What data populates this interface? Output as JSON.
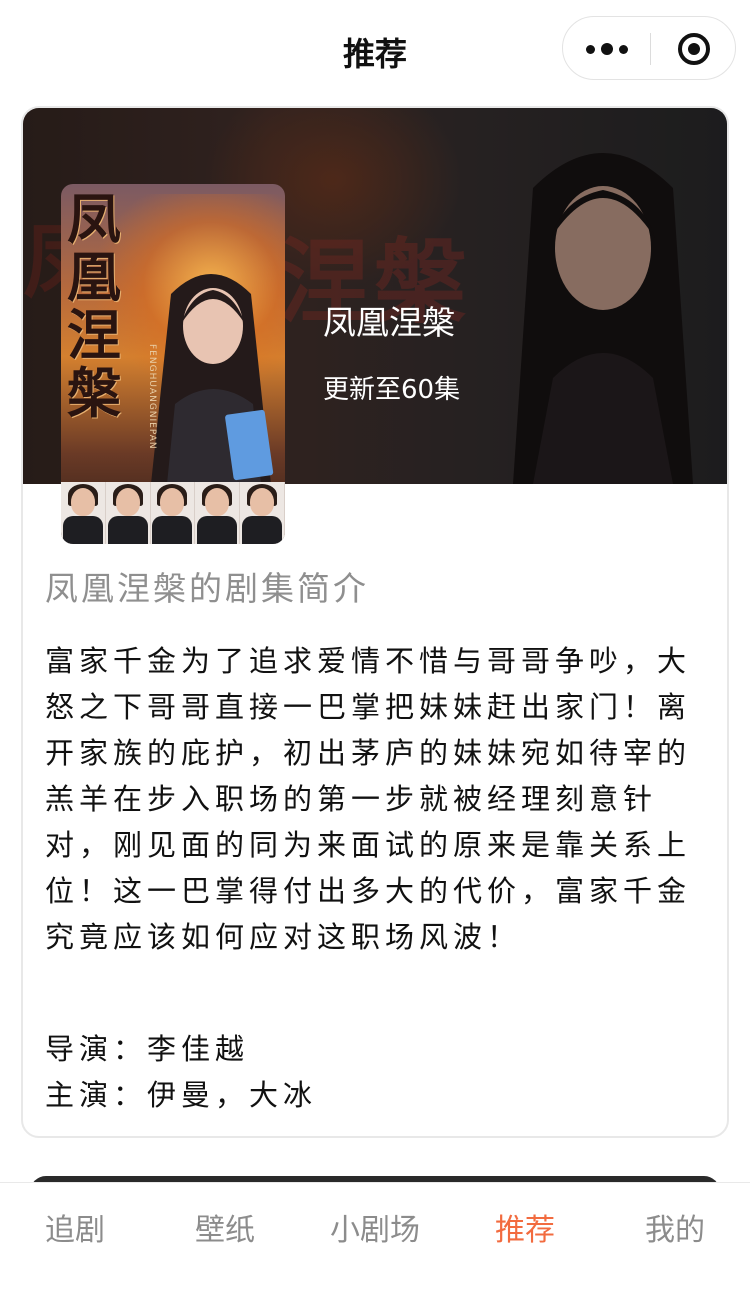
{
  "header": {
    "title": "推荐"
  },
  "capsule": {
    "more_icon": "more-dots-icon",
    "close_icon": "target-circle-icon"
  },
  "drama": {
    "poster_title": "凤凰涅槃",
    "poster_pinyin": "FENGHUANGNIEPAN",
    "title": "凤凰涅槃",
    "update_status": "更新至60集",
    "intro_heading": "凤凰涅槃的剧集简介",
    "intro": "富家千金为了追求爱情不惜与哥哥争吵，大怒之下哥哥直接一巴掌把妹妹赶出家门！离开家族的庇护，初出茅庐的妹妹宛如待宰的羔羊在步入职场的第一步就被经理刻意针对，刚见面的同为来面试的原来是靠关系上位！这一巴掌得付出多大的代价，富家千金究竟应该如何应对这职场风波！",
    "director": "导演：李佳越",
    "cast": "主演：伊曼，大冰"
  },
  "tabs": [
    {
      "label": "追剧",
      "active": false
    },
    {
      "label": "壁纸",
      "active": false
    },
    {
      "label": "小剧场",
      "active": false
    },
    {
      "label": "推荐",
      "active": true
    },
    {
      "label": "我的",
      "active": false
    }
  ],
  "colors": {
    "accent": "#f26b3f",
    "inactive_tab": "#8c8c8c",
    "intro_heading": "#8f8f8f"
  }
}
